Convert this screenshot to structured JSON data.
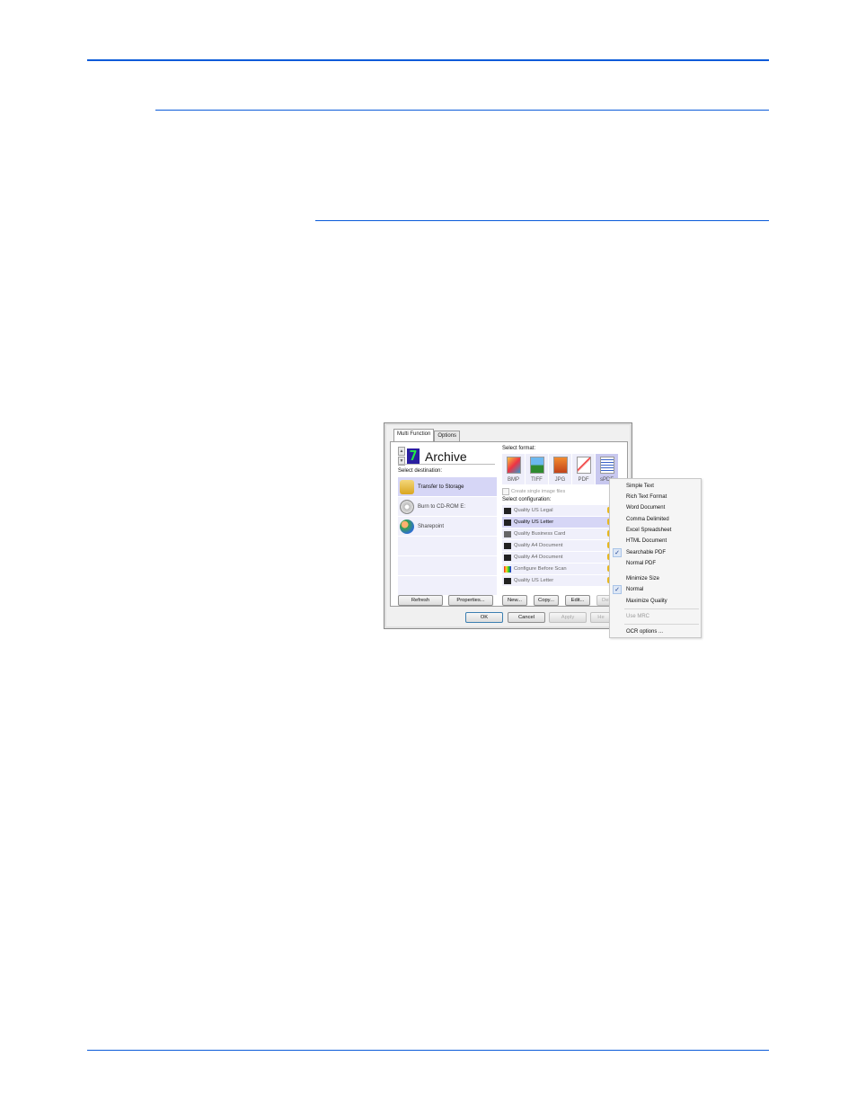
{
  "dialog": {
    "tabs": [
      {
        "label": "Multi Function",
        "active": true
      },
      {
        "label": "Options",
        "active": false
      }
    ],
    "destination_group": {
      "number": "7",
      "title": "Archive",
      "spin_up": "▲",
      "spin_down": "▼"
    },
    "select_destination_label": "Select destination:",
    "destinations": [
      {
        "label": "Transfer to Storage",
        "selected": true,
        "icon": "folder-storage-icon"
      },
      {
        "label": "Burn to CD-ROM  E:",
        "selected": false,
        "icon": "cd-drive-icon"
      },
      {
        "label": "Sharepoint",
        "selected": false,
        "icon": "sharepoint-icon"
      },
      {
        "label": "",
        "selected": false
      },
      {
        "label": "",
        "selected": false
      },
      {
        "label": "",
        "selected": false
      }
    ],
    "select_format_label": "Select format:",
    "formats": [
      {
        "label": "BMP",
        "selected": false,
        "icon": "bmp-file-icon"
      },
      {
        "label": "TIFF",
        "selected": false,
        "icon": "tiff-file-icon"
      },
      {
        "label": "JPG",
        "selected": false,
        "icon": "jpg-file-icon"
      },
      {
        "label": "PDF",
        "selected": false,
        "icon": "pdf-file-icon"
      },
      {
        "label": "sPDF",
        "selected": true,
        "icon": "spdf-file-icon"
      }
    ],
    "create_single_image_files": {
      "label": "Create single image files",
      "checked": false,
      "enabled": false
    },
    "select_configuration_label": "Select configuration:",
    "configurations": [
      {
        "label": "Quality US Legal",
        "selected": false,
        "icon": "scanner-icon",
        "locked": true
      },
      {
        "label": "Quality US Letter",
        "selected": true,
        "icon": "scanner-icon",
        "locked": true
      },
      {
        "label": "Quality Business Card",
        "selected": false,
        "icon": "card-scanner-icon",
        "locked": true
      },
      {
        "label": "Quality A4 Document",
        "selected": false,
        "icon": "scanner-icon",
        "locked": true
      },
      {
        "label": "Quality A4 Document",
        "selected": false,
        "icon": "scanner-icon",
        "locked": true
      },
      {
        "label": "Configure Before Scan",
        "selected": false,
        "icon": "configure-icon",
        "locked": true
      },
      {
        "label": "Quality US Letter",
        "selected": false,
        "icon": "scanner-icon",
        "locked": true
      }
    ],
    "buttons": {
      "refresh": "Refresh",
      "properties": "Properties...",
      "new": "New...",
      "copy": "Copy...",
      "edit": "Edit...",
      "delete": "Dele",
      "ok": "OK",
      "cancel": "Cancel",
      "apply": "Apply",
      "help": "He"
    }
  },
  "context_menu": {
    "items": [
      {
        "label": "Simple Text",
        "checked": false,
        "enabled": true
      },
      {
        "label": "Rich Text Format",
        "checked": false,
        "enabled": true
      },
      {
        "label": "Word Document",
        "checked": false,
        "enabled": true
      },
      {
        "label": "Comma Delimited",
        "checked": false,
        "enabled": true
      },
      {
        "label": "Excel Spreadsheet",
        "checked": false,
        "enabled": true
      },
      {
        "label": "HTML Document",
        "checked": false,
        "enabled": true
      },
      {
        "label": "Searchable PDF",
        "checked": true,
        "enabled": true
      },
      {
        "label": "Normal PDF",
        "checked": false,
        "enabled": true
      },
      {
        "label": "Minimize Size",
        "checked": false,
        "enabled": true
      },
      {
        "label": "Normal",
        "checked": true,
        "enabled": true
      },
      {
        "label": "Maximize Quality",
        "checked": false,
        "enabled": true
      },
      {
        "label": "Use MRC",
        "checked": false,
        "enabled": false
      },
      {
        "label": "OCR options ...",
        "checked": false,
        "enabled": true
      }
    ],
    "check_glyph": "✓"
  },
  "colors": {
    "rule": "#0a5bd9",
    "selection": "#d6d6f6",
    "list_bg": "#f0f0fb"
  }
}
